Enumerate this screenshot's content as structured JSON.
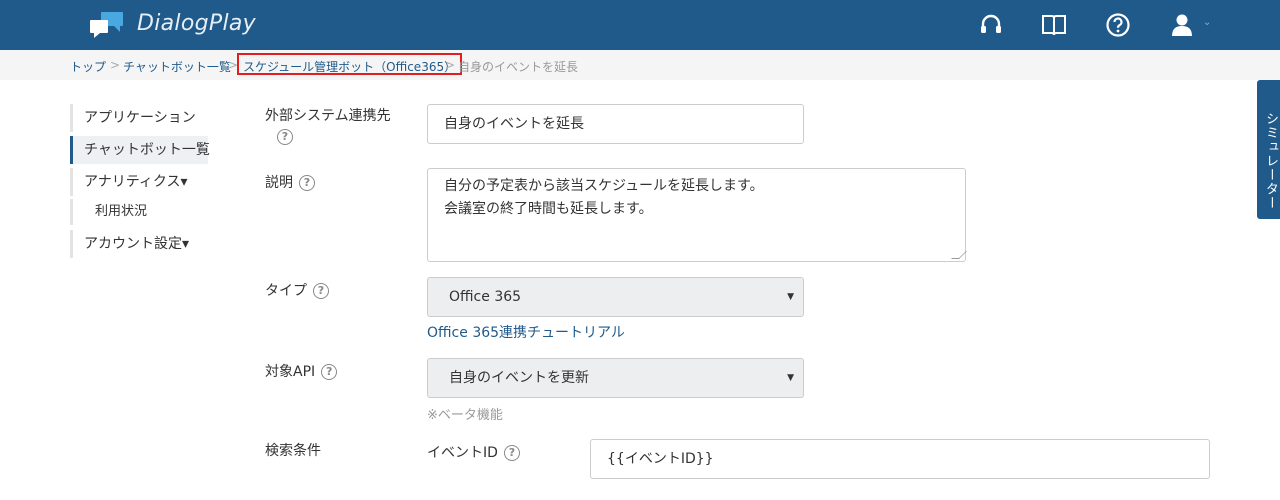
{
  "app": {
    "brand": "DialogPlay"
  },
  "header": {
    "icons": [
      "headset-icon",
      "book-icon",
      "help-icon",
      "user-icon",
      "chevron-down-icon"
    ]
  },
  "breadcrumb": {
    "items": [
      "トップ",
      "チャットボット一覧",
      "スケジュール管理ボット（Office365）",
      "自身のイベントを延長"
    ],
    "separator": ">"
  },
  "sidebar": {
    "items": [
      {
        "label": "アプリケーション"
      },
      {
        "label": "チャットボット一覧"
      },
      {
        "label": "アナリティクス▾"
      },
      {
        "label": "利用状況"
      },
      {
        "label": "アカウント設定▾"
      }
    ]
  },
  "form": {
    "external": {
      "label": "外部システム連携先",
      "value": "自身のイベントを延長"
    },
    "description": {
      "label": "説明",
      "line1": "自分の予定表から該当スケジュールを延長します。",
      "line2": "会議室の終了時間も延長します。"
    },
    "type": {
      "label": "タイプ",
      "value": "Office 365",
      "tutorial": "Office 365連携チュートリアル"
    },
    "api": {
      "label": "対象API",
      "value": "自身のイベントを更新",
      "note": "※ベータ機能"
    },
    "search": {
      "label": "検索条件",
      "param_label": "イベントID",
      "param_value": "{{イベントID}}"
    },
    "help_glyph": "?"
  },
  "simulator": {
    "label": "シミュレーター"
  },
  "colors": {
    "primary": "#1f5a8a",
    "highlight": "#e02020"
  }
}
